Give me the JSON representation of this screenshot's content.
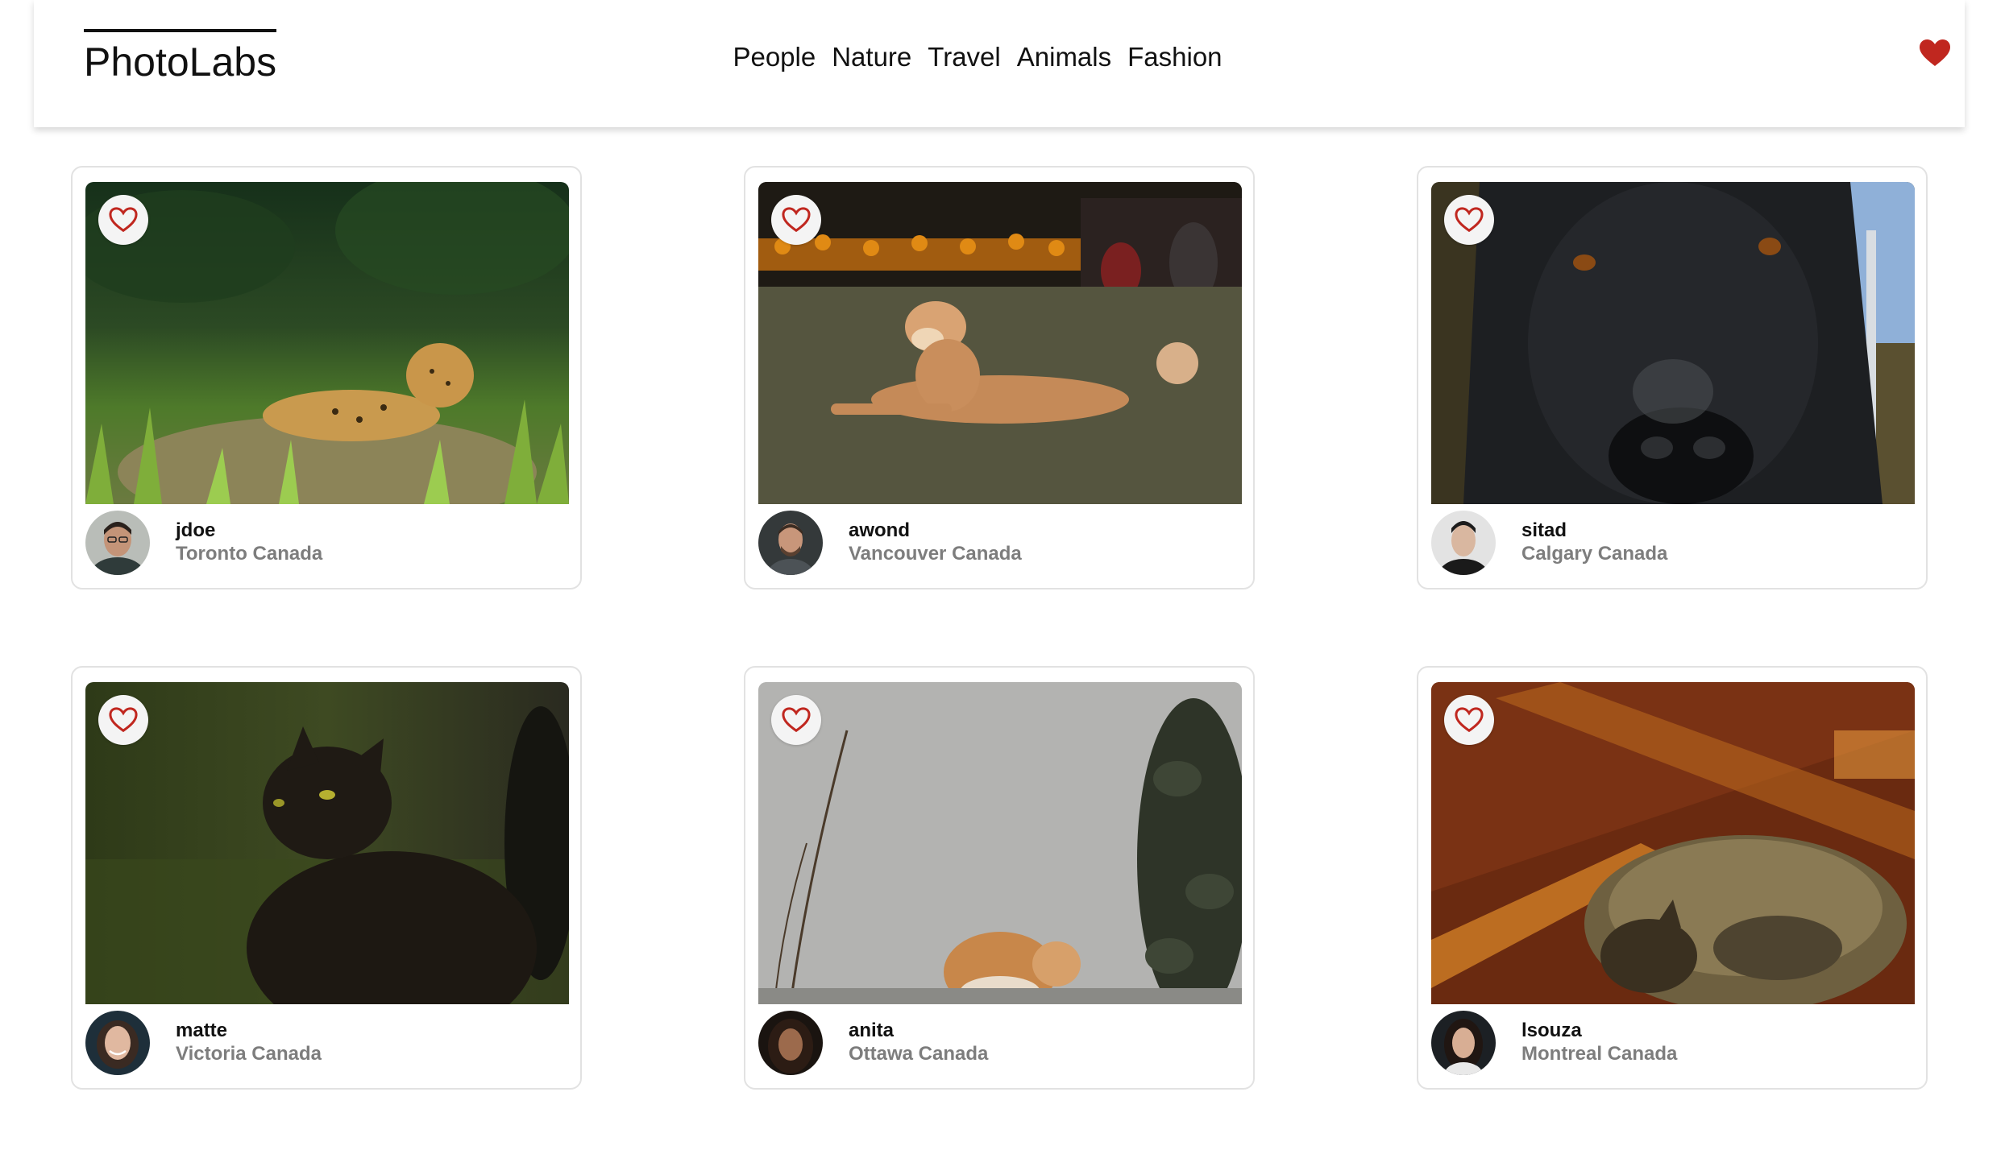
{
  "app": {
    "logo": "PhotoLabs"
  },
  "nav": {
    "topics": [
      "People",
      "Nature",
      "Travel",
      "Animals",
      "Fashion"
    ],
    "favourite_icon": "heart-filled-icon",
    "accent_color": "#c0271f"
  },
  "photos": [
    {
      "username": "jdoe",
      "location": "Toronto Canada",
      "subject": "jaguar",
      "fav_icon": "heart-outline-icon"
    },
    {
      "username": "awond",
      "location": "Vancouver Canada",
      "subject": "dog",
      "fav_icon": "heart-outline-icon"
    },
    {
      "username": "sitad",
      "location": "Calgary Canada",
      "subject": "black-dog",
      "fav_icon": "heart-outline-icon"
    },
    {
      "username": "matte",
      "location": "Victoria Canada",
      "subject": "black-cat",
      "fav_icon": "heart-outline-icon"
    },
    {
      "username": "anita",
      "location": "Ottawa Canada",
      "subject": "cat",
      "fav_icon": "heart-outline-icon"
    },
    {
      "username": "lsouza",
      "location": "Montreal Canada",
      "subject": "tabby-cat",
      "fav_icon": "heart-outline-icon"
    }
  ]
}
